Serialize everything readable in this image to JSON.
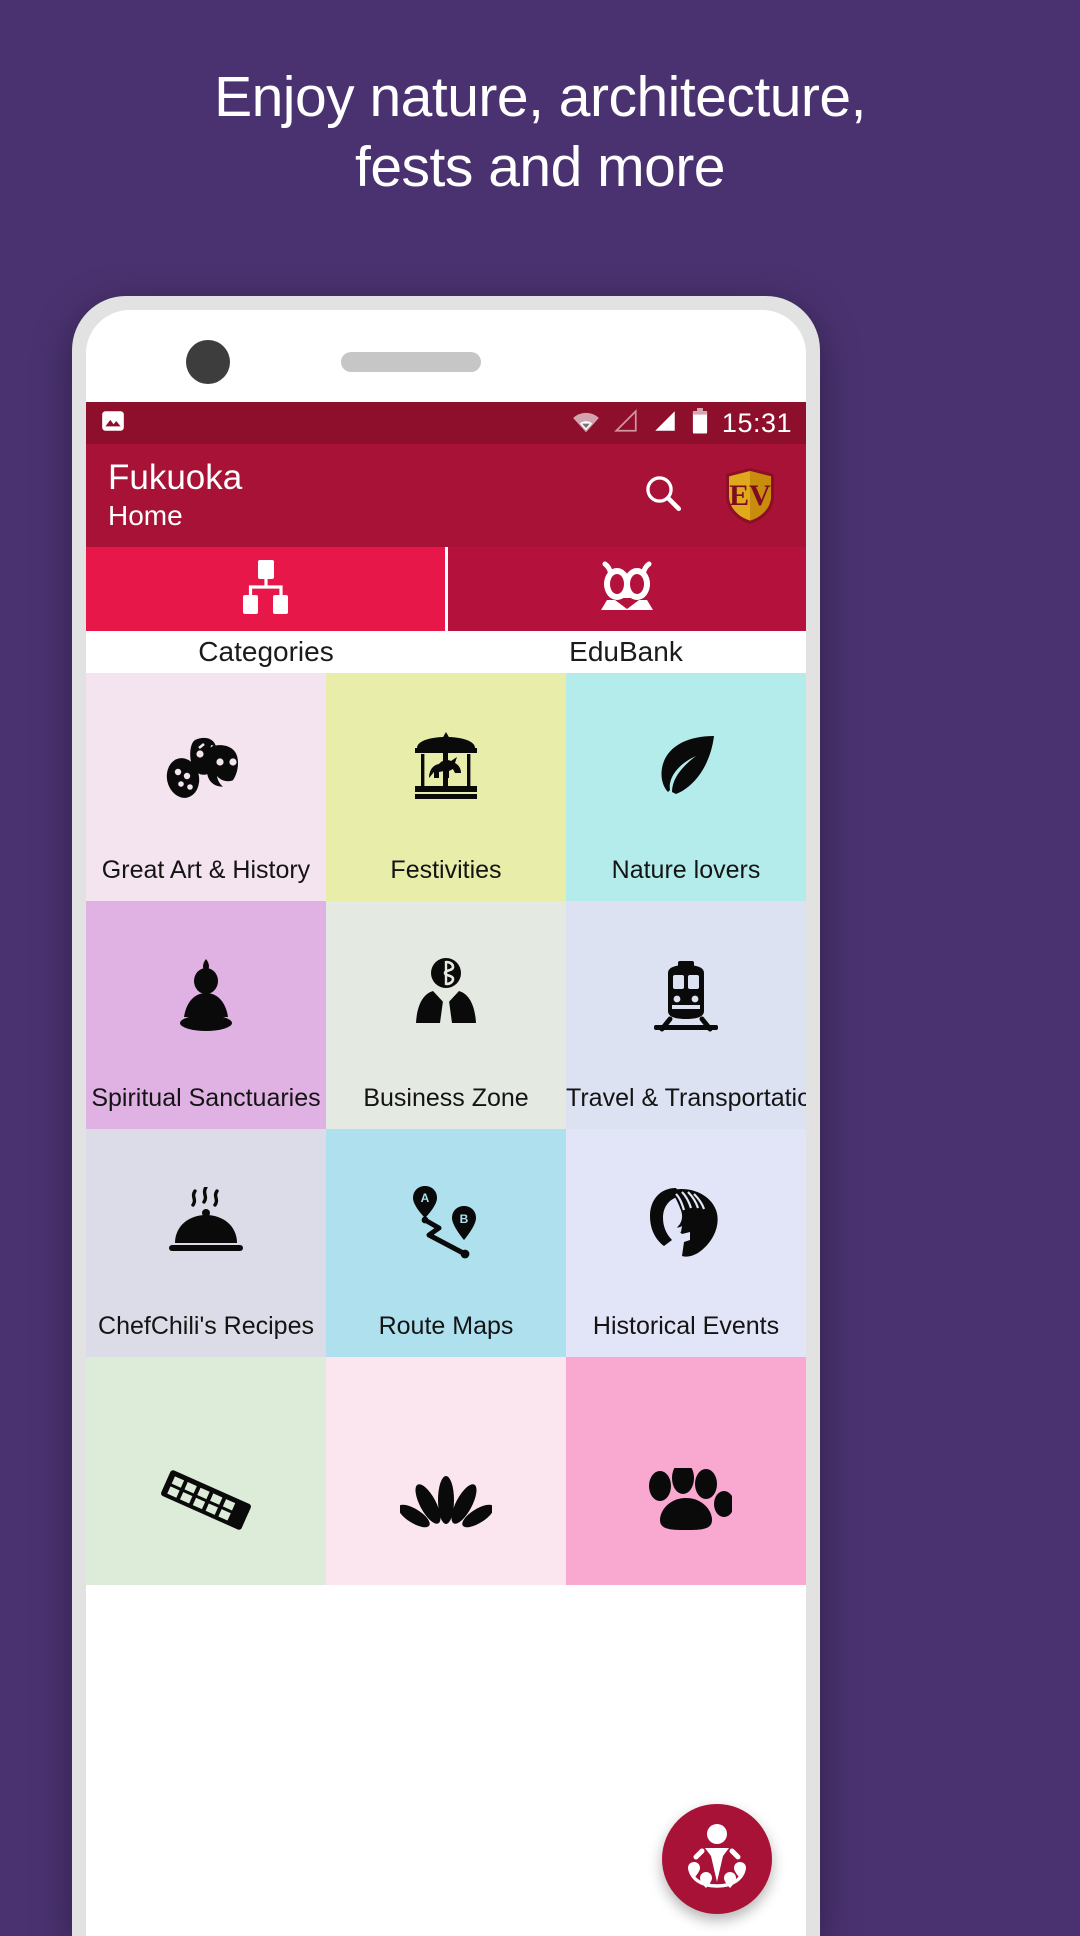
{
  "promo": {
    "line1": "Enjoy nature, architecture,",
    "line2": "fests and more",
    "background_color": "#4a3270",
    "text_color": "#ffffff"
  },
  "statusbar": {
    "time": "15:31",
    "icons": [
      "photo-icon",
      "wifi-icon",
      "signal-empty-icon",
      "signal-full-icon",
      "battery-icon"
    ],
    "background_color": "#8e0f2b"
  },
  "toolbar": {
    "title": "Fukuoka",
    "subtitle": "Home",
    "background_color": "#a81237",
    "search_label": "search-icon",
    "logo_text": "EV"
  },
  "tabs": [
    {
      "label": "Categories",
      "icon": "hierarchy-icon",
      "active": true,
      "color": "#e8174a"
    },
    {
      "label": "EduBank",
      "icon": "owl-icon",
      "active": false,
      "color": "#b4123c"
    }
  ],
  "grid": {
    "cells": [
      {
        "label": "Great Art & History",
        "icon": "theatre-masks-icon",
        "bg": "#f4e4ef"
      },
      {
        "label": "Festivities",
        "icon": "carousel-icon",
        "bg": "#e9edaa"
      },
      {
        "label": "Nature lovers",
        "icon": "leaf-icon",
        "bg": "#b4ecec"
      },
      {
        "label": "Spiritual Sanctuaries",
        "icon": "buddha-icon",
        "bg": "#e0b2e4"
      },
      {
        "label": "Business Zone",
        "icon": "businessman-icon",
        "bg": "#e4eae1"
      },
      {
        "label": "Travel & Transportation",
        "icon": "train-icon",
        "bg": "#dde2f2"
      },
      {
        "label": "ChefChili's Recipes",
        "icon": "food-cloche-icon",
        "bg": "#dcdbe8"
      },
      {
        "label": "Route Maps",
        "icon": "route-ab-icon",
        "bg": "#aee0ee"
      },
      {
        "label": "Historical Events",
        "icon": "spartan-helmet-icon",
        "bg": "#e2e4f7"
      },
      {
        "label": "",
        "icon": "film-strip-icon",
        "bg": "#dcecd8"
      },
      {
        "label": "",
        "icon": "flower-icon",
        "bg": "#fbe6f0"
      },
      {
        "label": "",
        "icon": "paw-print-icon",
        "bg": "#f9a8d0"
      }
    ]
  },
  "fab": {
    "icon": "people-locations-icon",
    "color": "#a81237"
  }
}
